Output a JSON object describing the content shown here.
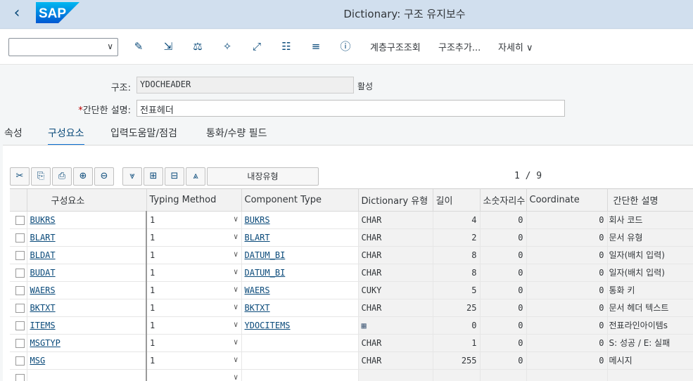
{
  "shell": {
    "title": "Dictionary: 구조 유지보수",
    "logo": "SAP",
    "back_icon": "chevron-left-icon"
  },
  "toolbar": {
    "select_value": "",
    "icons": [
      "pencil-glasses-icon",
      "export-icon",
      "balance-icon",
      "wand-icon",
      "navigate-icon",
      "hierarchy-icon",
      "stack-icon",
      "info-icon"
    ],
    "hierarchy_label": "계층구조조회",
    "append_label": "구조추가...",
    "more_label": "자세히"
  },
  "header": {
    "structure_label": "구조:",
    "structure_value": "YDOCHEADER",
    "status": "활성",
    "desc_label": "간단한 설명:",
    "desc_required": "*",
    "desc_value": "전표헤더"
  },
  "tabs": [
    "속성",
    "구성요소",
    "입력도움말/점검",
    "통화/수량 필드"
  ],
  "active_tab": 1,
  "grid_toolbar": {
    "buttons": [
      "cut-icon",
      "copy-icon",
      "paste-icon",
      "add-row-icon",
      "remove-row-icon",
      "collapse-down-icon",
      "insert-icon",
      "delete-icon",
      "expand-up-icon"
    ],
    "builtin_label": "내장유형",
    "pager": "1 / 9"
  },
  "columns": [
    "",
    "구성요소",
    "Typing Method",
    "Component Type",
    "Dictionary 유형",
    "길이",
    "소숫자리수",
    "Coordinate",
    "간단한 설명"
  ],
  "rows": [
    {
      "comp": "BUKRS",
      "tm": "1",
      "ctype": "BUKRS",
      "dtype": "CHAR",
      "len": "4",
      "dec": "0",
      "coord": "0",
      "desc": "회사 코드"
    },
    {
      "comp": "BLART",
      "tm": "1",
      "ctype": "BLART",
      "dtype": "CHAR",
      "len": "2",
      "dec": "0",
      "coord": "0",
      "desc": "문서 유형"
    },
    {
      "comp": "BLDAT",
      "tm": "1",
      "ctype": "DATUM_BI",
      "dtype": "CHAR",
      "len": "8",
      "dec": "0",
      "coord": "0",
      "desc": "일자(배치 입력)"
    },
    {
      "comp": "BUDAT",
      "tm": "1",
      "ctype": "DATUM_BI",
      "dtype": "CHAR",
      "len": "8",
      "dec": "0",
      "coord": "0",
      "desc": "일자(배치 입력)"
    },
    {
      "comp": "WAERS",
      "tm": "1",
      "ctype": "WAERS",
      "dtype": "CUKY",
      "len": "5",
      "dec": "0",
      "coord": "0",
      "desc": "통화 키"
    },
    {
      "comp": "BKTXT",
      "tm": "1",
      "ctype": "BKTXT",
      "dtype": "CHAR",
      "len": "25",
      "dec": "0",
      "coord": "0",
      "desc": "문서 헤더 텍스트"
    },
    {
      "comp": "ITEMS",
      "tm": "1",
      "ctype": "YDOCITEMS",
      "dtype": "table-type-icon",
      "len": "0",
      "dec": "0",
      "coord": "0",
      "desc": "전표라인아이템s"
    },
    {
      "comp": "MSGTYP",
      "tm": "1",
      "ctype": "",
      "dtype": "CHAR",
      "len": "1",
      "dec": "0",
      "coord": "0",
      "desc": "S: 성공 / E: 실패"
    },
    {
      "comp": "MSG",
      "tm": "1",
      "ctype": "",
      "dtype": "CHAR",
      "len": "255",
      "dec": "0",
      "coord": "0",
      "desc": "메시지"
    },
    {
      "comp": "",
      "tm": "",
      "ctype": "",
      "dtype": "",
      "len": "",
      "dec": "",
      "coord": "",
      "desc": ""
    }
  ]
}
